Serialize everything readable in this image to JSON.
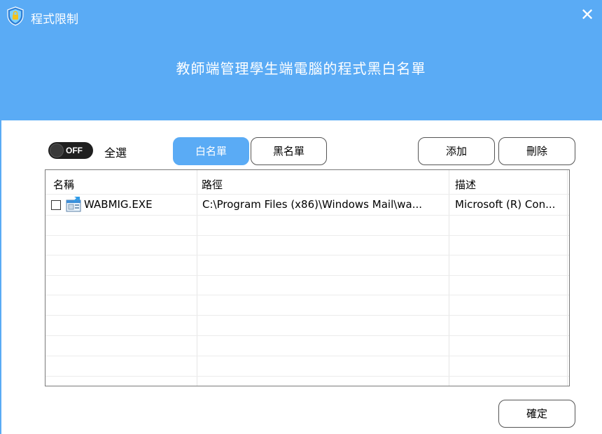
{
  "window": {
    "title": "程式限制",
    "close_glyph": "✕"
  },
  "header": {
    "subtitle": "教師端管理學生端電腦的程式黑白名單"
  },
  "colors": {
    "accent": "#5aabf5",
    "toggle_bg": "#1f1f1f"
  },
  "toolbar": {
    "toggle_state": "OFF",
    "select_all_label": "全選",
    "whitelist_label": "白名單",
    "blacklist_label": "黑名單",
    "active_list": "whitelist",
    "add_label": "添加",
    "delete_label": "刪除"
  },
  "table": {
    "columns": [
      "名稱",
      "路徑",
      "描述"
    ],
    "rows": [
      {
        "checked": false,
        "icon": "executable-icon",
        "name": "WABMIG.EXE",
        "path": "C:\\Program Files (x86)\\Windows Mail\\wa...",
        "description": "Microsoft (R) Con..."
      }
    ]
  },
  "footer": {
    "confirm_label": "確定"
  }
}
